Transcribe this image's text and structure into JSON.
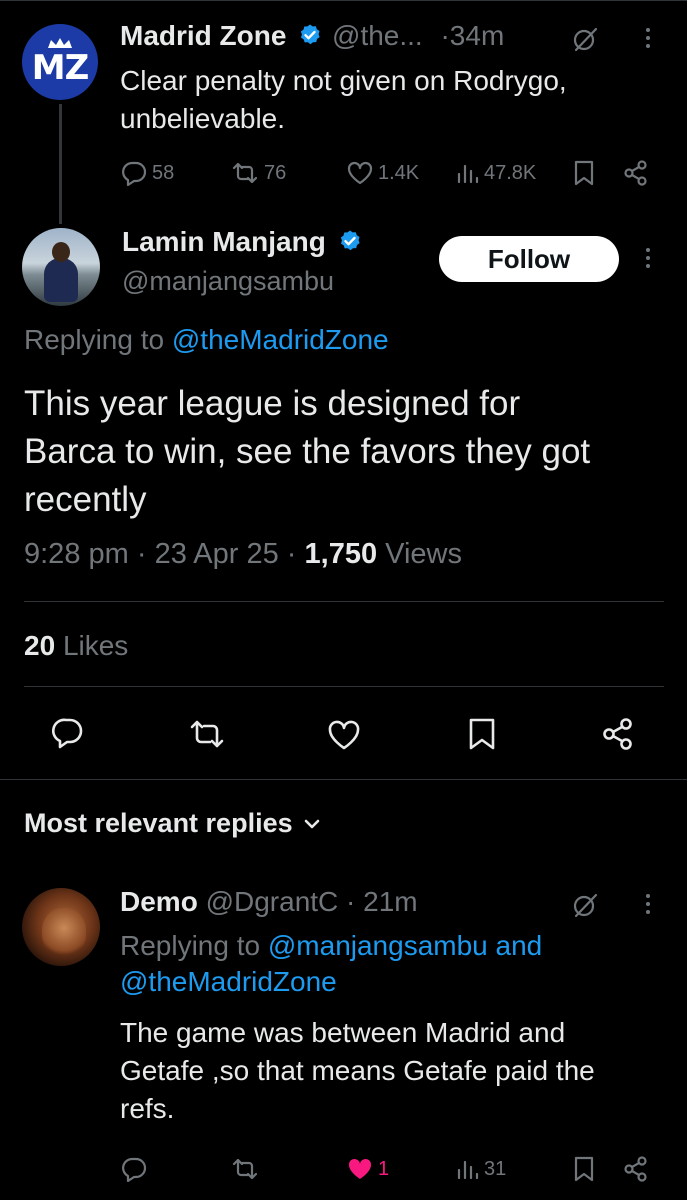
{
  "parent_tweet": {
    "avatar_text": "MZ",
    "name": "Madrid Zone",
    "handle": "@the...",
    "time": "·34m",
    "text_line1": "Clear penalty not given on Rodrygo,",
    "text_line2": "unbelievable.",
    "replies": "58",
    "retweets": "76",
    "likes": "1.4K",
    "views": "47.8K"
  },
  "main_tweet": {
    "name": "Lamin Manjang",
    "handle": "@manjangsambu",
    "follow_label": "Follow",
    "replying_prefix": "Replying to",
    "replying_to": "@theMadridZone",
    "text_line1": "This year league is designed for",
    "text_line2": "Barca to win, see the favors they got",
    "text_line3": "recently",
    "time": "9:28 pm",
    "date": "23 Apr 25",
    "views_count": "1,750",
    "views_label": "Views",
    "likes_count": "20",
    "likes_label": "Likes"
  },
  "replies_section": {
    "title": "Most relevant replies"
  },
  "reply": {
    "name": "Demo",
    "handle": "@DgrantC",
    "time": "· 21m",
    "replying_prefix": "Replying to",
    "replying_to_1": "@manjangsambu",
    "replying_and": "and",
    "replying_to_2": "@theMadridZone",
    "text_line1": "The game was between Madrid and",
    "text_line2": "Getafe ,so that means Getafe paid the",
    "text_line3": "refs.",
    "likes": "1",
    "views": "31"
  },
  "colors": {
    "background": "#000000",
    "text": "#e7e9ea",
    "muted": "#71767b",
    "link": "#1d9bf0",
    "verified": "#1d9bf0",
    "liked": "#f91880",
    "divider": "#2f3336"
  }
}
